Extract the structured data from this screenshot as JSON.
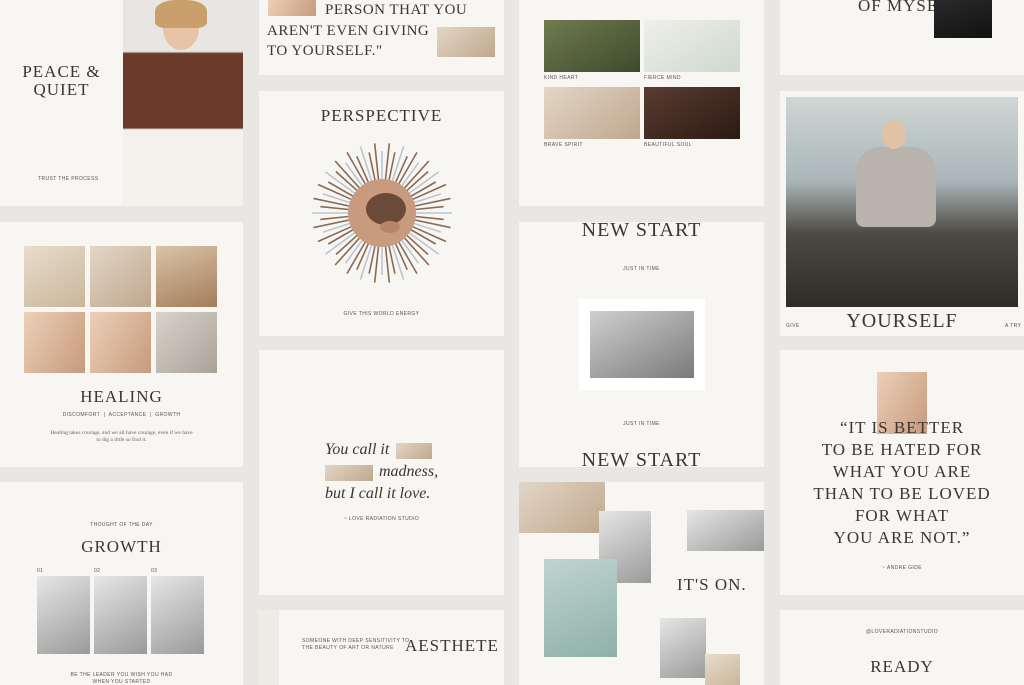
{
  "cards": {
    "peace": {
      "title_line1": "PEACE &",
      "title_line2": "QUIET",
      "caption": "TRUST THE PROCESS"
    },
    "quote_top": {
      "line1": "PERSON THAT YOU",
      "line2": "AREN'T EVEN GIVING",
      "line3": "TO YOURSELF.\""
    },
    "moodboard": {
      "labels": [
        "KIND HEART",
        "FIERCE MIND",
        "BRAVE SPIRIT",
        "BEAUTIFUL SOUL"
      ]
    },
    "myself": {
      "title": "OF MYSELF"
    },
    "perspective": {
      "title": "PERSPECTIVE",
      "caption": "GIVE THIS WORLD ENERGY"
    },
    "new_start": {
      "title": "NEW START",
      "caption_top": "JUST IN TIME",
      "caption_bottom": "JUST IN TIME"
    },
    "yourself": {
      "title": "YOURSELF",
      "left": "GIVE",
      "right": "A TRY"
    },
    "healing": {
      "title": "HEALING",
      "tags": "DISCOMFORT  |  ACCEPTANCE  |  GROWTH",
      "body_line1": "Healing takes courage, and we all have courage, even if we have",
      "body_line2": "to dig a little so find it."
    },
    "you_call": {
      "line1": "You call it",
      "line2": "madness,",
      "line3": "but I call it love.",
      "credit": "~ LOVE RADIATION STUDIO"
    },
    "new_start_bottom": {
      "title": "NEW START"
    },
    "quote_gide": {
      "line1": "“IT IS BETTER",
      "line2": "TO BE HATED FOR",
      "line3": "WHAT YOU ARE",
      "line4": "THAN TO BE LOVED",
      "line5": "FOR WHAT",
      "line6": "YOU ARE NOT.”",
      "credit": "~ ANDRE GIDE"
    },
    "growth": {
      "eyebrow": "THOUGHT OF THE DAY",
      "title": "GROWTH",
      "nums": [
        "01",
        "02",
        "03"
      ],
      "caption_line1": "BE THE LEADER YOU WISH YOU HAD",
      "caption_line2": "WHEN YOU STARTED"
    },
    "its_on": {
      "title": "IT'S ON."
    },
    "aesthete": {
      "text_line1": "SOMEONE WITH DEEP SENSITIVITY TO",
      "text_line2": "THE BEAUTY OF ART OR NATURE",
      "title": "AESTHETE"
    },
    "ready": {
      "handle": "@LOVERADIATIONSTUDIO",
      "title": "READY"
    }
  }
}
